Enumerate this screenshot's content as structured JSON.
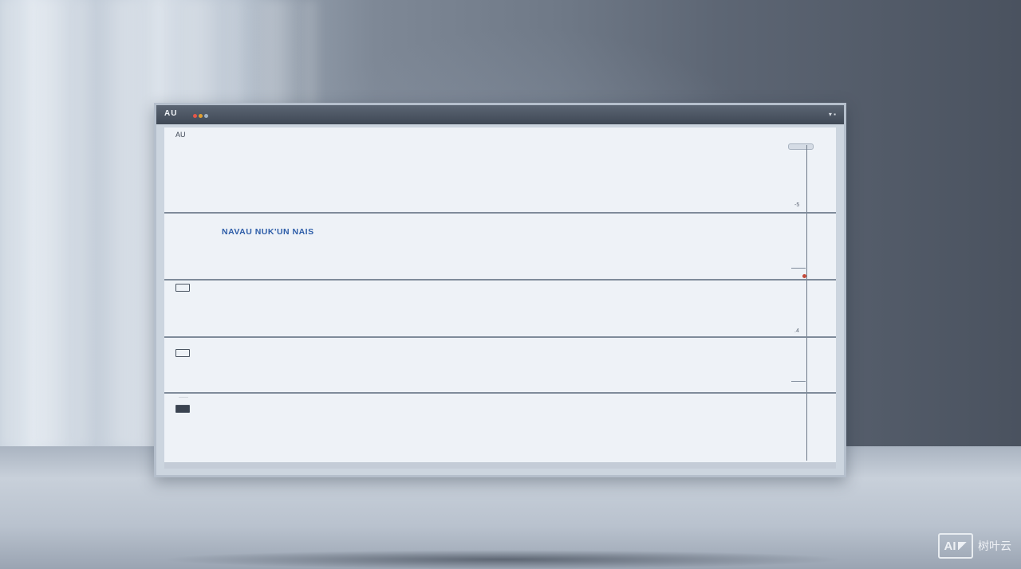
{
  "window": {
    "title": "AU",
    "subtitle": "",
    "controls": "▾ ▪",
    "dot_colors": [
      "#e4574a",
      "#e0a030",
      "#9fb2c6"
    ]
  },
  "sections": [
    {
      "tag": "AU",
      "tag_sub": "",
      "headline": "",
      "lines": []
    },
    {
      "tag": "",
      "tag_sub": "",
      "headline_pre": "",
      "headline_hl": "NAVAU NUK'UN NAIS",
      "headline_post": "",
      "lines": []
    },
    {
      "tag": "",
      "headline": "",
      "lines": []
    },
    {
      "tag": "",
      "headline": "",
      "lines": []
    },
    {
      "tag": "",
      "headline": "",
      "lines": []
    }
  ],
  "watermark": {
    "logo": "AI",
    "text": "树叶云"
  }
}
